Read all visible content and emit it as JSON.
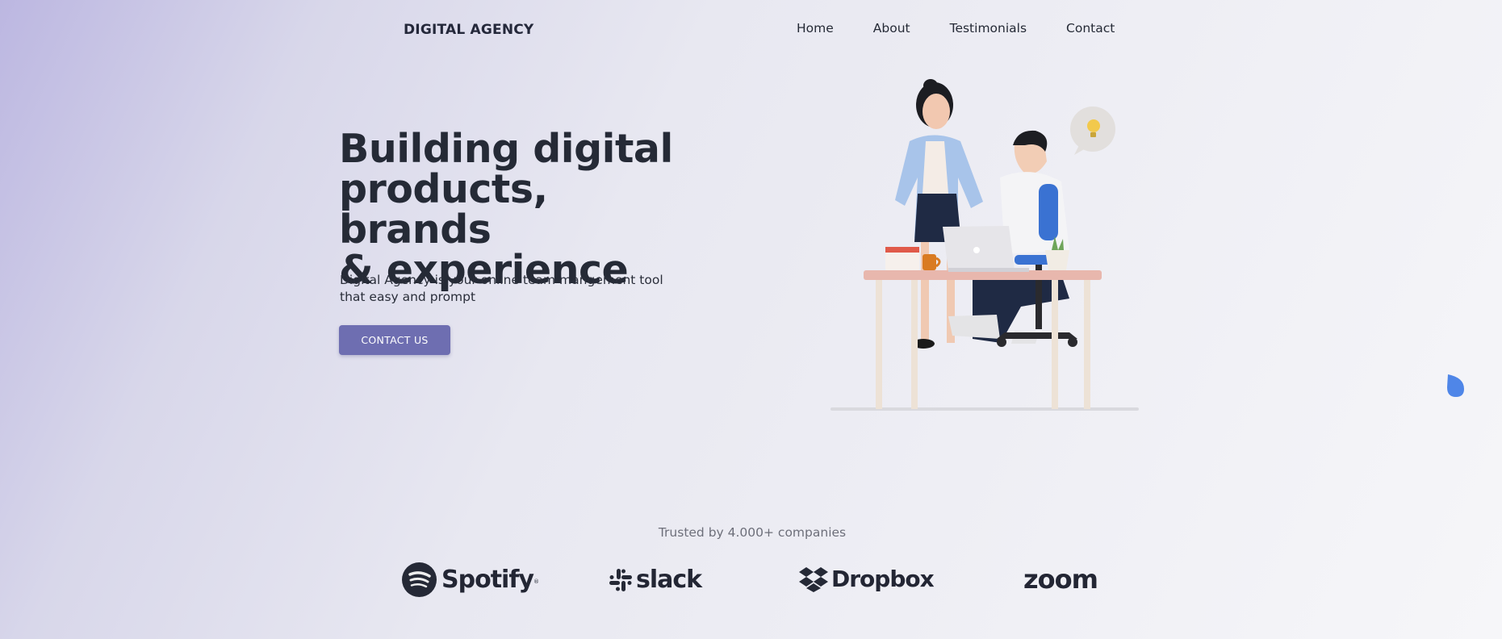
{
  "header": {
    "brand": "DIGITAL AGENCY",
    "nav": [
      {
        "label": "Home"
      },
      {
        "label": "About"
      },
      {
        "label": "Testimonials"
      },
      {
        "label": "Contact"
      }
    ]
  },
  "hero": {
    "title_line1": "Building digital",
    "title_line2": "products, brands",
    "title_line3": "& experience",
    "subtitle": "Digital Agency is your online team mangement tool that easy and prompt",
    "cta_label": "CONTACT US"
  },
  "trusted": {
    "text": "Trusted by 4.000+ companies",
    "logos": [
      {
        "name": "Spotify",
        "icon": "spotify-icon"
      },
      {
        "name": "slack",
        "icon": "slack-icon"
      },
      {
        "name": "Dropbox",
        "icon": "dropbox-icon"
      },
      {
        "name": "zoom",
        "icon": "zoom-logo"
      }
    ]
  },
  "colors": {
    "accent": "#6e6eb1",
    "text": "#252a36",
    "droplet": "#4f86e8"
  }
}
